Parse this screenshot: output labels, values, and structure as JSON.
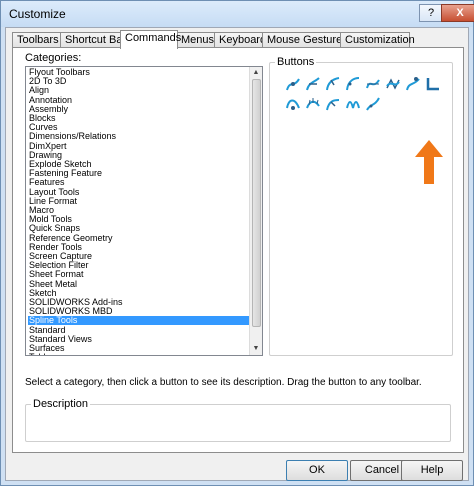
{
  "window": {
    "title": "Customize",
    "help_glyph": "?",
    "close_glyph": "X"
  },
  "tabs": [
    {
      "label": "Toolbars"
    },
    {
      "label": "Shortcut Bars"
    },
    {
      "label": "Commands",
      "active": true
    },
    {
      "label": "Menus"
    },
    {
      "label": "Keyboard"
    },
    {
      "label": "Mouse Gestures"
    },
    {
      "label": "Customization"
    }
  ],
  "categories": {
    "label": "Categories:",
    "items": [
      "Flyout Toolbars",
      "2D To 3D",
      "Align",
      "Annotation",
      "Assembly",
      "Blocks",
      "Curves",
      "Dimensions/Relations",
      "DimXpert",
      "Drawing",
      "Explode Sketch",
      "Fastening Feature",
      "Features",
      "Layout Tools",
      "Line Format",
      "Macro",
      "Mold Tools",
      "Quick Snaps",
      "Reference Geometry",
      "Render Tools",
      "Screen Capture",
      "Selection Filter",
      "Sheet Format",
      "Sheet Metal",
      "Sketch",
      "SOLIDWORKS Add-ins",
      "SOLIDWORKS MBD",
      "Spline Tools",
      "Standard",
      "Standard Views",
      "Surfaces",
      "Table"
    ],
    "selected": "Spline Tools"
  },
  "buttons": {
    "label": "Buttons",
    "icons": [
      "insert-spline-point-icon",
      "add-tangency-control-icon",
      "add-curvature-control-icon",
      "insert-spline-control-icon",
      "simplify-spline-icon",
      "fit-spline-icon",
      "show-spline-handles-icon",
      "show-inflection-points-icon",
      "style-spline-icon",
      "show-curvature-combs-icon",
      "show-minimum-radius-icon",
      "spline-on-surface-icon",
      "equation-spline-icon",
      "convert-to-spline-icon",
      "sketch-fillet-spline-icon"
    ],
    "accent_color": "#1f9ad6",
    "pointer_arrow_color": "#f07818"
  },
  "hint_text": "Select a category, then click a button to see its description. Drag the button to any toolbar.",
  "description": {
    "label": "Description",
    "value": ""
  },
  "footer": {
    "ok_label": "OK",
    "cancel_label": "Cancel",
    "help_label": "Help"
  }
}
